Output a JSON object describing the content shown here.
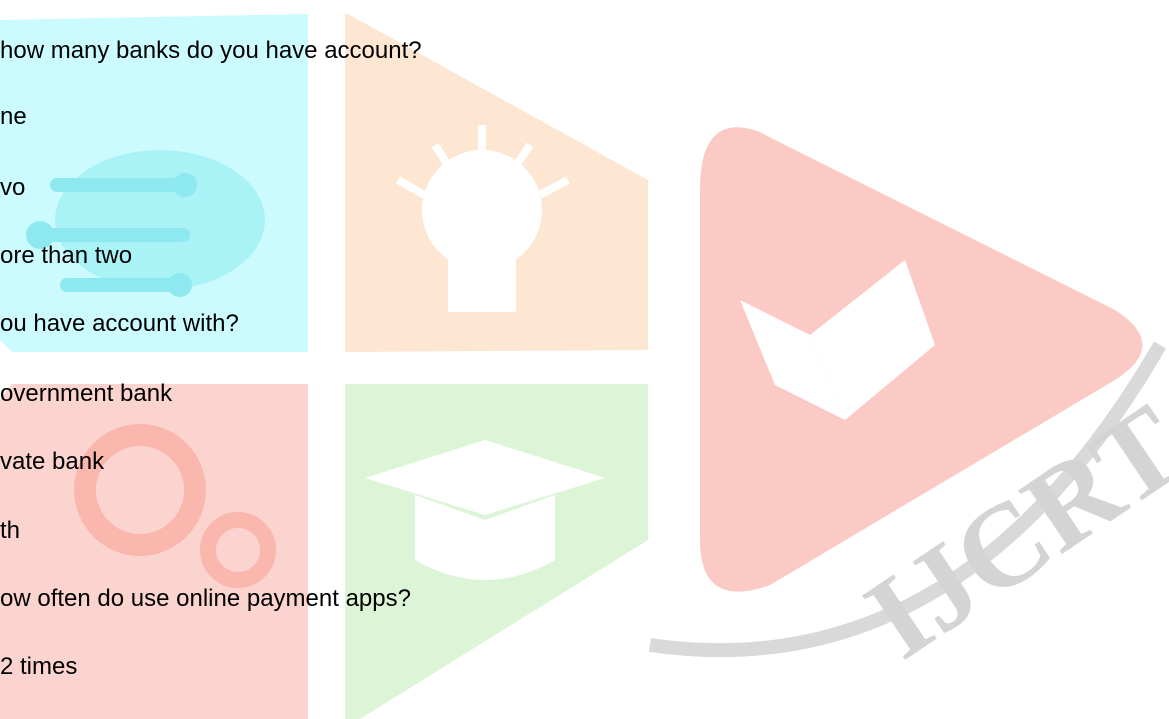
{
  "watermark": {
    "logo_text": "IJCRT",
    "colors": {
      "cyan_panel": "#ccfbff",
      "orange_panel": "#fde6d2",
      "red_panel": "#fcd4cf",
      "green_panel": "#dcf5d7",
      "play_triangle": "#fbcac4",
      "swoosh": "#d9d9d9"
    }
  },
  "document": {
    "lines": [
      "how many banks do you have account?",
      "ne",
      "vo",
      "ore than two",
      "ou have account with?",
      "overnment bank",
      "vate bank",
      "th",
      "ow often do use online payment apps?",
      "2 times"
    ]
  }
}
